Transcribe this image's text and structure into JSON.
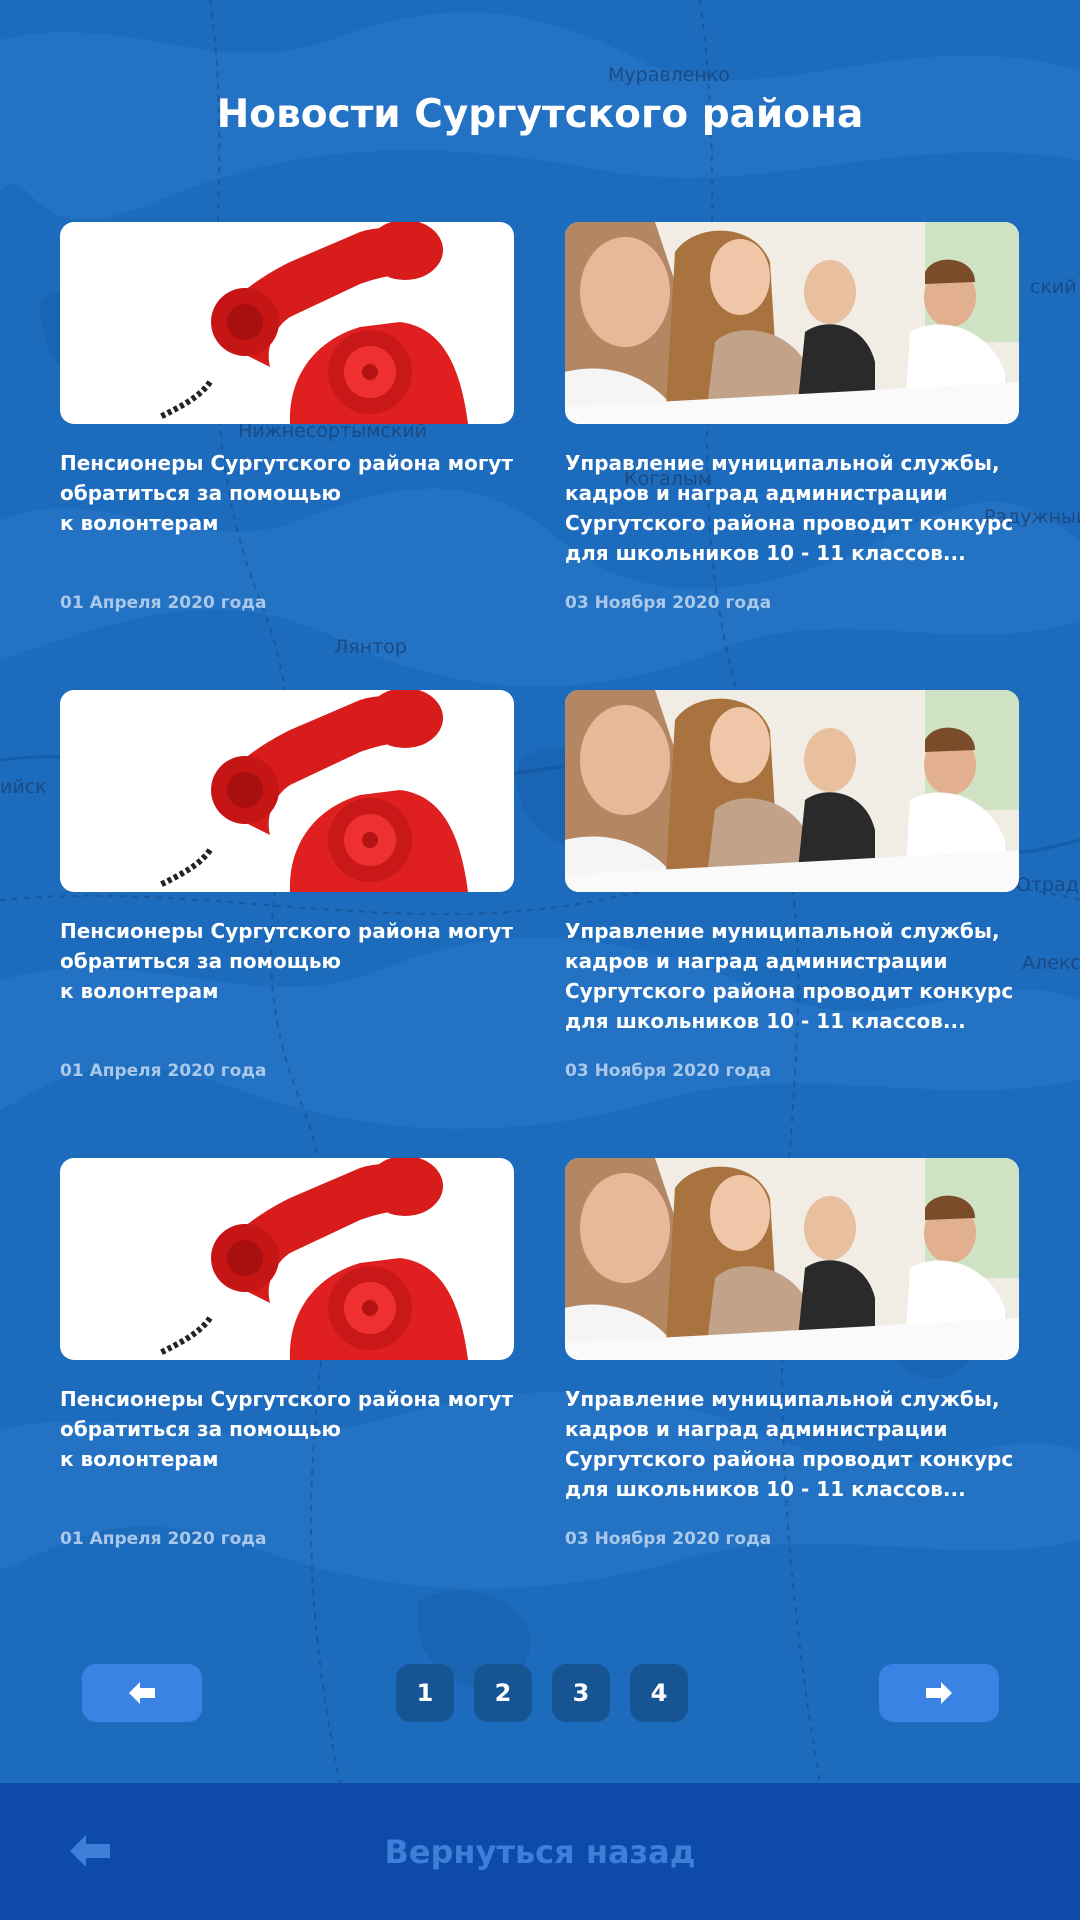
{
  "page": {
    "title": "Новости Сургутского района"
  },
  "map_labels": [
    "Муравленко",
    "Когалым",
    "Нижнесортымский",
    "Лянтор",
    "Радужный",
    "Отрадный",
    "Алекс",
    "ийск",
    "ский"
  ],
  "news": [
    {
      "image": "red-telephone",
      "title": "Пенсионеры Сургутского района могут\nобратиться за помощью\nк волонтерам",
      "date": "01 Апреля 2020 года"
    },
    {
      "image": "students-at-desks",
      "title": "Управление муниципальной службы,\nкадров и наград администрации\nСургутского района проводит конкурс\nдля школьников 10 - 11 классов...",
      "date": "03 Ноября 2020 года"
    },
    {
      "image": "red-telephone",
      "title": "Пенсионеры Сургутского района могут\nобратиться за помощью\nк волонтерам",
      "date": "01 Апреля 2020 года"
    },
    {
      "image": "students-at-desks",
      "title": "Управление муниципальной службы,\nкадров и наград администрации\nСургутского района проводит конкурс\nдля школьников 10 - 11 классов...",
      "date": "03 Ноября 2020 года"
    },
    {
      "image": "red-telephone",
      "title": "Пенсионеры Сургутского района могут\nобратиться за помощью\nк волонтерам",
      "date": "01 Апреля 2020 года"
    },
    {
      "image": "students-at-desks",
      "title": "Управление муниципальной службы,\nкадров и наград администрации\nСургутского района проводит конкурс\nдля школьников 10 - 11 классов...",
      "date": "03 Ноября 2020 года"
    }
  ],
  "pagination": {
    "prev_icon": "arrow-left-icon",
    "next_icon": "arrow-right-icon",
    "pages": [
      "1",
      "2",
      "3",
      "4"
    ]
  },
  "footer": {
    "back_label": "Вернуться назад",
    "back_icon": "arrow-left-icon"
  },
  "colors": {
    "background": "#1c6bbd",
    "accent": "#3a82e4",
    "footer": "#0e4aa8",
    "page_button": "#175494"
  }
}
